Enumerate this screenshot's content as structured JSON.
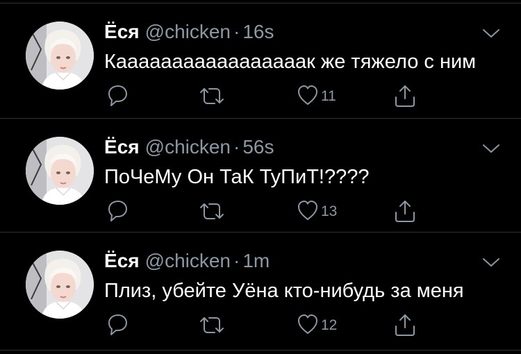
{
  "colors": {
    "background": "#000000",
    "primary_text": "#ffffff",
    "secondary_text": "#8b98a5",
    "divider": "#2f3336"
  },
  "icons": {
    "reply": "speech-bubble-icon",
    "retweet": "retweet-icon",
    "like": "heart-icon",
    "share": "share-icon",
    "more": "chevron-down-icon"
  },
  "tweets": [
    {
      "author_name": "Ёся",
      "author_handle": "@chicken",
      "separator": "·",
      "time": "16s",
      "text": "Кааааааааааааааааак же тяжело с ним",
      "like_count": "11"
    },
    {
      "author_name": "Ёся",
      "author_handle": "@chicken",
      "separator": "·",
      "time": "56s",
      "text": "ПоЧеМу Он ТаК ТуПиТ!????",
      "like_count": "13"
    },
    {
      "author_name": "Ёся",
      "author_handle": "@chicken",
      "separator": "·",
      "time": "1m",
      "text": "Плиз, убейте Уёна кто-нибудь за меня",
      "like_count": "12"
    }
  ]
}
